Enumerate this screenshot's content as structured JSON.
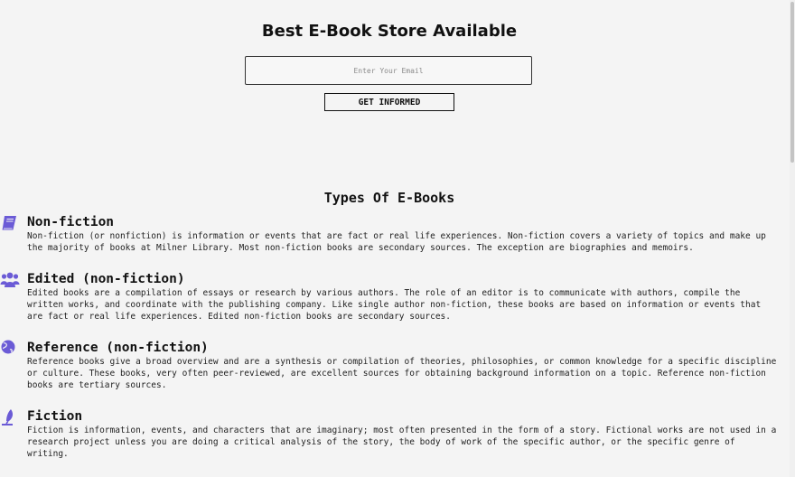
{
  "colors": {
    "background": "#f4f4f4",
    "icon": "#6b5bd6",
    "text": "#111111"
  },
  "hero": {
    "title": "Best E-Book Store Available",
    "email_placeholder": "Enter Your Email",
    "button_label": "GET INFORMED"
  },
  "types": {
    "title": "Types Of E-Books",
    "items": [
      {
        "icon": "book-icon",
        "title": "Non-fiction",
        "description": "Non-fiction (or nonfiction) is information or events that are fact or real life experiences. Non-fiction covers a variety of topics and make up the majority of books at Milner Library. Most non-fiction books are secondary sources. The exception are biographies and memoirs."
      },
      {
        "icon": "users-icon",
        "title": "Edited (non-fiction)",
        "description": "Edited books are a compilation of essays or research by various authors. The role of an editor is to communicate with authors, compile the written works, and coordinate with the publishing company. Like single author non-fiction, these books are based on information or events that are fact or real life experiences. Edited non-fiction books are secondary sources."
      },
      {
        "icon": "globe-icon",
        "title": "Reference (non-fiction)",
        "description": "Reference books give a broad overview and are a synthesis or compilation of theories, philosophies, or common knowledge for a specific discipline or culture. These books, very often peer-reviewed, are excellent sources for obtaining background information on a topic. Reference non-fiction books are tertiary sources."
      },
      {
        "icon": "feather-pen-icon",
        "title": "Fiction",
        "description": "Fiction is information, events, and characters that are imaginary; most often presented in the form of a story. Fictional works are not used in a research project unless you are doing a critical analysis of the story, the body of work of the specific author, or the specific genre of writing."
      }
    ]
  }
}
